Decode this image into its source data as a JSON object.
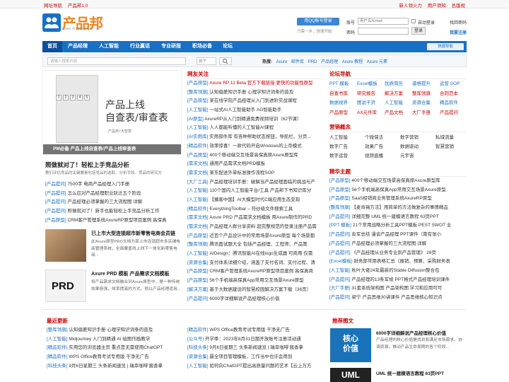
{
  "topbar": {
    "left": [
      "网址导航",
      "产品邦1.0"
    ],
    "right": [
      "新人领火力",
      "用户须知",
      "总版视"
    ]
  },
  "logo": {
    "text": "产品邦",
    "sub": "www.mastershell.cn"
  },
  "qq": {
    "label": "用QQ帐号登录",
    "sub": "只需一步，快速开始"
  },
  "login": {
    "account_label": "账号",
    "account_placeholder": "用户名/Email",
    "password_label": "密码",
    "auto_login": "自动登录",
    "find_password": "找回密码",
    "login_btn": "登录",
    "register": "我要注册"
  },
  "nav": {
    "items": [
      "首页",
      "产品经理",
      "人工智能",
      "行业赢话",
      "专业研报",
      "职场必备",
      "论坛"
    ],
    "fast": "快捷导航"
  },
  "search": {
    "placeholder": "请输入搜索内容",
    "select": "帖子",
    "hot_label": "热搜:",
    "hot": [
      "Axure",
      "邮件库",
      "PRD",
      "产品经理",
      "Axure 教程",
      "Axure 元素"
    ]
  },
  "banner": {
    "line1": "产品上线",
    "line2": "自查表/审查表",
    "small": "产品邦×大智慧",
    "caption": "PM必备 产品上线自查表/产品上线审查表",
    "nums": [
      "1",
      "2",
      "3",
      "4",
      "5"
    ]
  },
  "lead": {
    "title": "照做就对了！轻松上手竞品分析",
    "sub": "教们评估竞品的关键要素包括竞品的选取、分析手段、竞品的研究方"
  },
  "left_list": [
    {
      "tag": "[产品提问]",
      "text": "7500字 电商产品经理入门手册"
    },
    {
      "tag": "[产品提问]",
      "text": "怎么应对产品经理职业跃迁五个阶段"
    },
    {
      "tag": "[产品提问]",
      "text": "产品经理必须掌握的三大流程图 详解"
    },
    {
      "tag": "[产品提问]",
      "text": "照做就对了！新手也能轻松上手竞品分析工作"
    },
    {
      "tag": "[产品原型]",
      "text": "CRM客户管理系统AxureRP原型项目案例 高保真"
    }
  ],
  "articles": [
    {
      "title": "已上市大型连锁超市新零售电商会员链",
      "desc": "此Axure原型PRD文档为某上市连锁超市多店铺电商管理系统，全面覆盖线上线下一体化新零售电商..."
    },
    {
      "title": "Axure PRD 模板 产品需求文档模板",
      "desc": "将产品需求文档融合到Axure原型中，是一种传统效果极强，效率提高的方式，很以产品经理适用..."
    }
  ],
  "prd_thumb": "PRD",
  "mid_head": "网友关注",
  "mid_list": [
    {
      "tag": "[产品原型]",
      "text": "Axure RP 11 Beta 官方下载链接 更快的功能性原型"
    },
    {
      "tag": "[整库领旗]",
      "text": "认知偏差知识手册 心理学知识词条的普及"
    },
    {
      "tag": "[产品原型]",
      "text": "某在线学院产品经理从入门到进阶实战课程"
    },
    {
      "tag": "[人工智能]",
      "text": "一站式AI人工智能助手 AG智能助手"
    },
    {
      "tag": "[AI原型]",
      "text": "AxureRP从入门到精通免费视频培训（62节课）"
    },
    {
      "tag": "[人工智能]",
      "text": "人人都能听懂的人工智能AI课程"
    },
    {
      "tag": "[AI实用库]",
      "text": "实用部件库 有各种帮助状态按钮，导航栏、分页..."
    },
    {
      "tag": "[精品软件]",
      "text": "效率惊喜！一款代码开启Windows的上帝模式"
    },
    {
      "tag": "[产品原型]",
      "text": "400个移动端交互场景高保真原Axure原型库"
    },
    {
      "tag": "[需求文档]",
      "text": "通用产品需求文档PRD模板"
    },
    {
      "tag": "[需求文档]",
      "text": "某东配送外单标准操作流程SOP"
    },
    {
      "tag": "[大厂工具]",
      "text": "产品经理培训手册：破解当产品经理面临的挑战与产"
    },
    {
      "tag": "[人工智能]",
      "text": "110个国内人工智能平台/工具 产品邦下书知识库分"
    },
    {
      "tag": "[人工智能]",
      "text": "【播客中国】AI大模型时代C端应用生态变现"
    },
    {
      "tag": "[精品软件]",
      "text": "EverythingToolbar – 符纱级文件搜索工具"
    },
    {
      "tag": "[需求文档]",
      "text": "Axure PRD 产品需求文档模板 用Axure制作的PRD"
    },
    {
      "tag": "[需求文档]",
      "text": "产品经理人群分享资料 超完整规范的登录注册产品需"
    },
    {
      "tag": "[产品原型]",
      "text": "近百个产品设计中的常用场景Axure原型 每个场景都"
    },
    {
      "tag": "[整库领旗]",
      "text": "腾讯面试题大全 包括产品经理、工程师、产品策"
    },
    {
      "tag": "[人工智能]",
      "text": "AIDesign：腾讯智能AI在线logo生成器 可商用 仅需"
    },
    {
      "tag": "[资源合集]",
      "text": "支付体系详细介绍，涵盖了支付名词、支付过程、清"
    },
    {
      "tag": "[产品原型]",
      "text": "CRM客户管理系统AxureRP原型项目案例 高保真商"
    },
    {
      "tag": "[产品原型]",
      "text": "56个手机端高保真App常用交互场景Axure原型"
    },
    {
      "tag": "[解决方案]",
      "text": "基于大数据建设的智慧校园解决方案下载（36页）"
    },
    {
      "tag": "[产品提问]",
      "text": "6000字详细解说产品经理核心价值"
    }
  ],
  "right_head1": "论坛导航",
  "forum_nav": [
    [
      "PPT 模板",
      "Excel模板",
      "优质简历",
      "逼格提升",
      "运营 SOP"
    ],
    [
      "自查书库",
      "研究报告",
      "解决方案",
      "整库领旗",
      "合同范本"
    ],
    [
      "数据视界",
      "图说干货",
      "人工智能",
      "资源合集",
      "精品软件"
    ],
    [
      "产品原型",
      "AX元件库",
      "产品文档",
      "大厂手册",
      "产品提问"
    ]
  ],
  "right_head2": "营销概念",
  "marketing": [
    [
      "人工智能",
      "个微保法",
      "数字营销",
      "私域流量"
    ],
    [
      "数字广告",
      "效果广告",
      "数据驱动",
      "智慧营销"
    ],
    [
      "数字运营",
      "视频直播",
      "元宇宙",
      ""
    ]
  ],
  "right_head3": "精华主题",
  "essence_list": [
    {
      "tag": "[产品原型]",
      "text": "400个移动端交互场景高保真原Axure原型库"
    },
    {
      "tag": "[产品原型]",
      "text": "56个手机端高保真App常用交互场景Axure原型"
    },
    {
      "tag": "[产品原型]",
      "text": "SaaS经销商业务管理系统AxureRP原型"
    },
    {
      "tag": "[整库领旗]",
      "text": "【麦肯锡方法】用简单的方法做复杂的事情精品"
    },
    {
      "tag": "[产品提问]",
      "text": "详细完整 UML 统一建模语言教程 63页PPT"
    },
    {
      "tag": "[PPT 模板]",
      "text": "21个常用战略分析工具PPT模板 PEST SWOT 业"
    },
    {
      "tag": "[产品提问]",
      "text": "俞军总结 漫谈产品经理 PPT课件（南有张小"
    },
    {
      "tag": "[产品提问]",
      "text": "产品经理必须掌握的三大流程图 详解"
    },
    {
      "tag": "[产品提问]",
      "text": "《产品经理从业务专业到产品管理》 28页"
    },
    {
      "tag": "[Excel模板]",
      "text": "财务部常用表格汇总（报销、预算、采购财务表"
    },
    {
      "tag": "[人工智能]",
      "text": "秋叶大佬24年最新的Stable Diffusion整合包"
    },
    {
      "tag": "[产品提问]",
      "text": "产品经理的13条军规 PPT格式产品经理培训课件"
    },
    {
      "tag": "[大厂手册]",
      "text": "31套系统架构图 产品架构图 学习和应用可可"
    },
    {
      "tag": "[产品提问]",
      "text": "梁宁·产品思维30讲课件 产品思维核心知识点"
    }
  ],
  "bottom": {
    "latest_head": "最近更新",
    "latest_left": [
      {
        "tag": "[整库领旗]",
        "text": "认知偏差知识手册 心理学知识词条的普及"
      },
      {
        "tag": "[人工智能]",
        "text": "Midjourney 入门到精通 AI 绘图作画教学"
      },
      {
        "tag": "[精品软件]",
        "text": "实用您的浏览器主页 重点是无需使用ChatGPT"
      },
      {
        "tag": "[精品软件]",
        "text": "WPS Office教育考试专用版 干净无广告"
      },
      {
        "tag": "[科技头条]",
        "text": "9月6日星期三 头条新闻速览 | 瑞幸咖啡'酱香拿"
      }
    ],
    "latest_mid": [
      {
        "tag": "[精品软件]",
        "text": "WPS Office教育考试专用版 干净无广告"
      },
      {
        "tag": "[公众号]",
        "text": "开学季：2023年8月31日期开放账号注册活动通"
      },
      {
        "tag": "[科技头条]",
        "text": "9月6日星期三 头条新闻速览 | 瑞幸咖啡'酱香拿"
      },
      {
        "tag": "[资源合集]",
        "text": "最全项目管理模板，工作当中也许会用到"
      },
      {
        "tag": "[人工智能]",
        "text": "如何向ChatGPT提出高质量问题的艺术【云上万方"
      }
    ],
    "rec_head": "推荐图文",
    "rec": [
      {
        "title": "6000字详细解说产品经理核心价值",
        "desc": "产品经理的核心价值是找到和满足市场需求，协调资源，推动产品生命周期的各个阶段..."
      },
      {
        "title": "UML 统一建模语言教程 63页PPT",
        "desc": "UML是面向对象的软件..."
      }
    ],
    "ad1": "核心\n价值",
    "ad2": "UML"
  }
}
